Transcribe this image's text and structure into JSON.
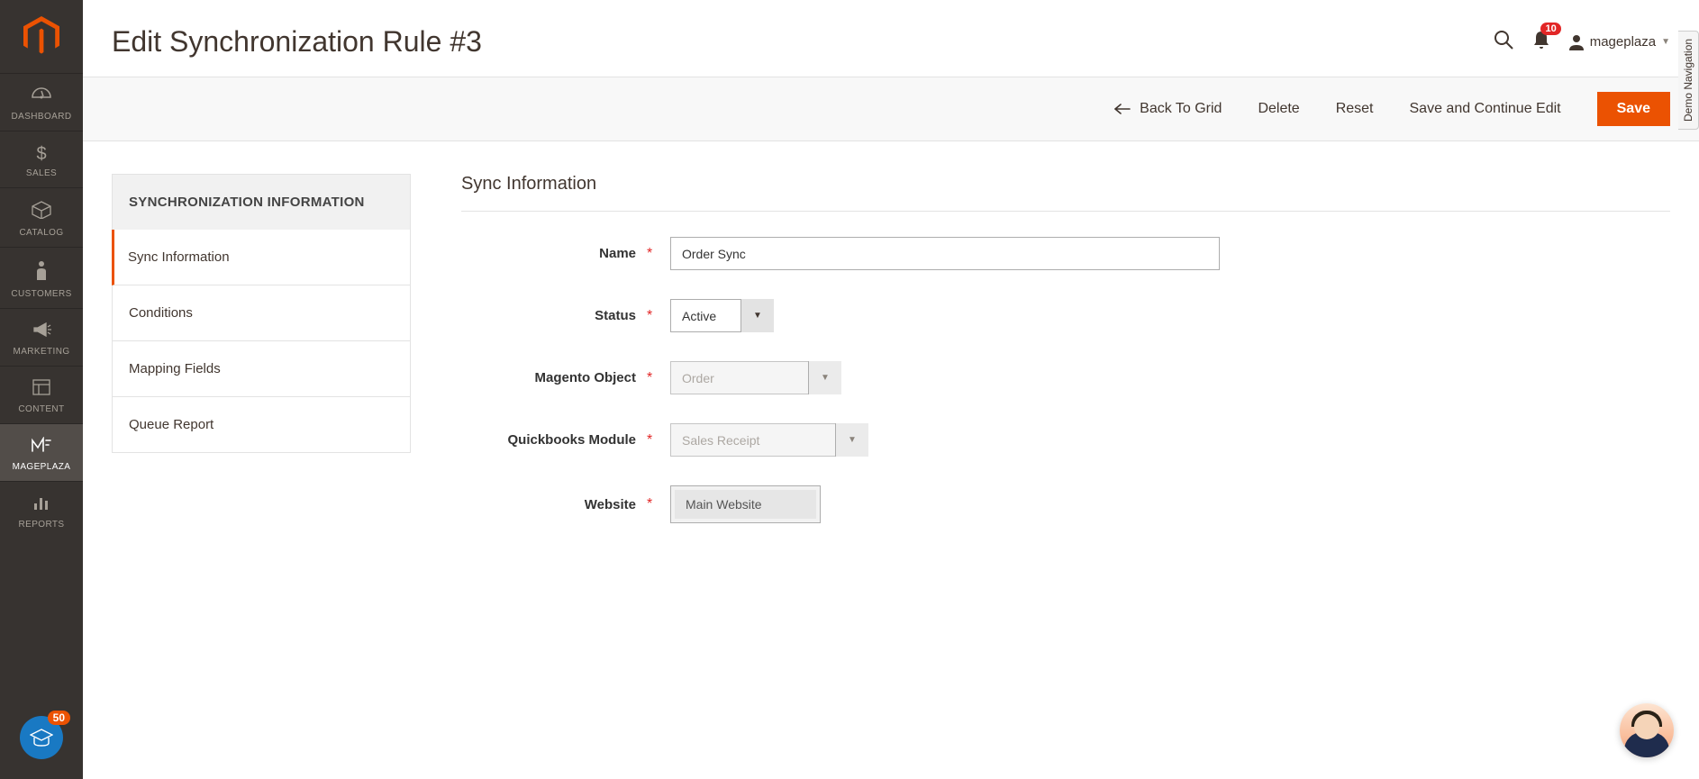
{
  "nav": {
    "items": [
      {
        "label": "DASHBOARD",
        "icon": "dashboard"
      },
      {
        "label": "SALES",
        "icon": "dollar"
      },
      {
        "label": "CATALOG",
        "icon": "box"
      },
      {
        "label": "CUSTOMERS",
        "icon": "person"
      },
      {
        "label": "MARKETING",
        "icon": "megaphone"
      },
      {
        "label": "CONTENT",
        "icon": "layout"
      },
      {
        "label": "MAGEPLAZA",
        "icon": "mageplaza"
      },
      {
        "label": "REPORTS",
        "icon": "reports"
      }
    ],
    "academy_count": "50"
  },
  "header": {
    "title": "Edit Synchronization Rule #3",
    "notification_count": "10",
    "username": "mageplaza"
  },
  "actions": {
    "back": "Back To Grid",
    "delete": "Delete",
    "reset": "Reset",
    "save_continue": "Save and Continue Edit",
    "save": "Save"
  },
  "tabs": {
    "header": "SYNCHRONIZATION INFORMATION",
    "items": [
      {
        "label": "Sync Information",
        "active": true
      },
      {
        "label": "Conditions",
        "active": false
      },
      {
        "label": "Mapping Fields",
        "active": false
      },
      {
        "label": "Queue Report",
        "active": false
      }
    ]
  },
  "form": {
    "section_title": "Sync Information",
    "fields": {
      "name": {
        "label": "Name",
        "value": "Order Sync"
      },
      "status": {
        "label": "Status",
        "value": "Active"
      },
      "magento_object": {
        "label": "Magento Object",
        "value": "Order"
      },
      "quickbooks_module": {
        "label": "Quickbooks Module",
        "value": "Sales Receipt"
      },
      "website": {
        "label": "Website",
        "value": "Main Website"
      }
    }
  },
  "demo_nav": "Demo Navigation"
}
